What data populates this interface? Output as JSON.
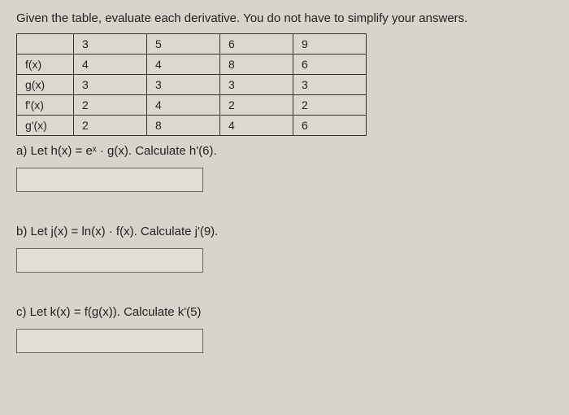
{
  "instruction": "Given the table, evaluate each derivative. You do not have to simplify your answers.",
  "table": {
    "headers": [
      "",
      "3",
      "5",
      "6",
      "9"
    ],
    "rows": [
      {
        "label": "f(x)",
        "values": [
          "4",
          "4",
          "8",
          "6"
        ]
      },
      {
        "label": "g(x)",
        "values": [
          "3",
          "3",
          "3",
          "3"
        ]
      },
      {
        "label": "f'(x)",
        "values": [
          "2",
          "4",
          "2",
          "2"
        ]
      },
      {
        "label": "g'(x)",
        "values": [
          "2",
          "8",
          "4",
          "6"
        ]
      }
    ]
  },
  "parts": {
    "a": "a) Let h(x) = eˣ · g(x). Calculate h'(6).",
    "b": "b) Let j(x) = ln(x) · f(x). Calculate j'(9).",
    "c": "c) Let k(x) = f(g(x)). Calculate k'(5)"
  },
  "chart_data": {
    "type": "table",
    "title": "Function value table for derivative evaluation",
    "columns": [
      "x",
      "f(x)",
      "g(x)",
      "f'(x)",
      "g'(x)"
    ],
    "rows": [
      {
        "x": 3,
        "f(x)": 4,
        "g(x)": 3,
        "f'(x)": 2,
        "g'(x)": 2
      },
      {
        "x": 5,
        "f(x)": 4,
        "g(x)": 3,
        "f'(x)": 4,
        "g'(x)": 8
      },
      {
        "x": 6,
        "f(x)": 8,
        "g(x)": 3,
        "f'(x)": 2,
        "g'(x)": 4
      },
      {
        "x": 9,
        "f(x)": 6,
        "g(x)": 3,
        "f'(x)": 2,
        "g'(x)": 6
      }
    ]
  }
}
